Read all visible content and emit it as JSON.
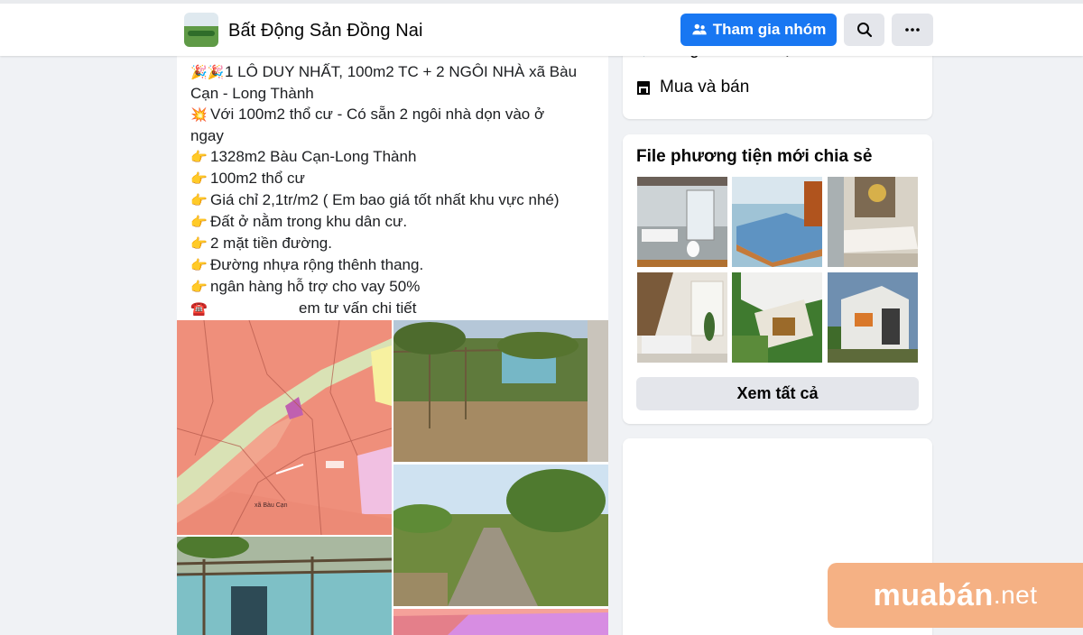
{
  "header": {
    "group_name": "Bất Động Sản Đồng Nai",
    "join_label": "Tham gia nhóm",
    "search_icon": "search-icon",
    "more_icon": "more-icon"
  },
  "post": {
    "lines": [
      {
        "emoji": "🎉🎉",
        "text": "1 LÔ DUY NHẤT, 100m2 TC + 2 NGÔI NHÀ xã Bàu"
      },
      {
        "emoji": "",
        "text": "Cạn - Long Thành"
      },
      {
        "emoji": "💥",
        "text": "Với 100m2 thổ cư - Có sẵn 2 ngôi nhà dọn vào ở"
      },
      {
        "emoji": "",
        "text": "ngay"
      },
      {
        "emoji": "👉",
        "text": "1328m2 Bàu Cạn-Long Thành"
      },
      {
        "emoji": "👉",
        "text": "100m2 thổ cư"
      },
      {
        "emoji": "👉",
        "text": "Giá chỉ 2,1tr/m2 ( Em bao giá tốt nhất khu vực nhé)"
      },
      {
        "emoji": "👉",
        "text": "Đất ở nằm trong khu dân cư."
      },
      {
        "emoji": "👉",
        "text": "2 mặt tiền đường."
      },
      {
        "emoji": "👉",
        "text": "Đường nhựa rộng thênh thang."
      },
      {
        "emoji": "👉",
        "text": "ngân hàng hỗ trợ cho vay 50%"
      },
      {
        "emoji": "☎️",
        "text": "em tư vấn chi tiết"
      }
    ],
    "map_label": "xã Bàu Cạn"
  },
  "sidebar": {
    "about_partial": "Long Thành · Việt Nam",
    "about_category": "Mua và bán",
    "media_title": "File phương tiện mới chia sẻ",
    "see_all_label": "Xem tất cả"
  },
  "watermark": {
    "main": "muabán",
    "suffix": ".net"
  },
  "colors": {
    "accent": "#1877f2",
    "page_bg": "#f0f2f5",
    "watermark": "#f5b184"
  }
}
